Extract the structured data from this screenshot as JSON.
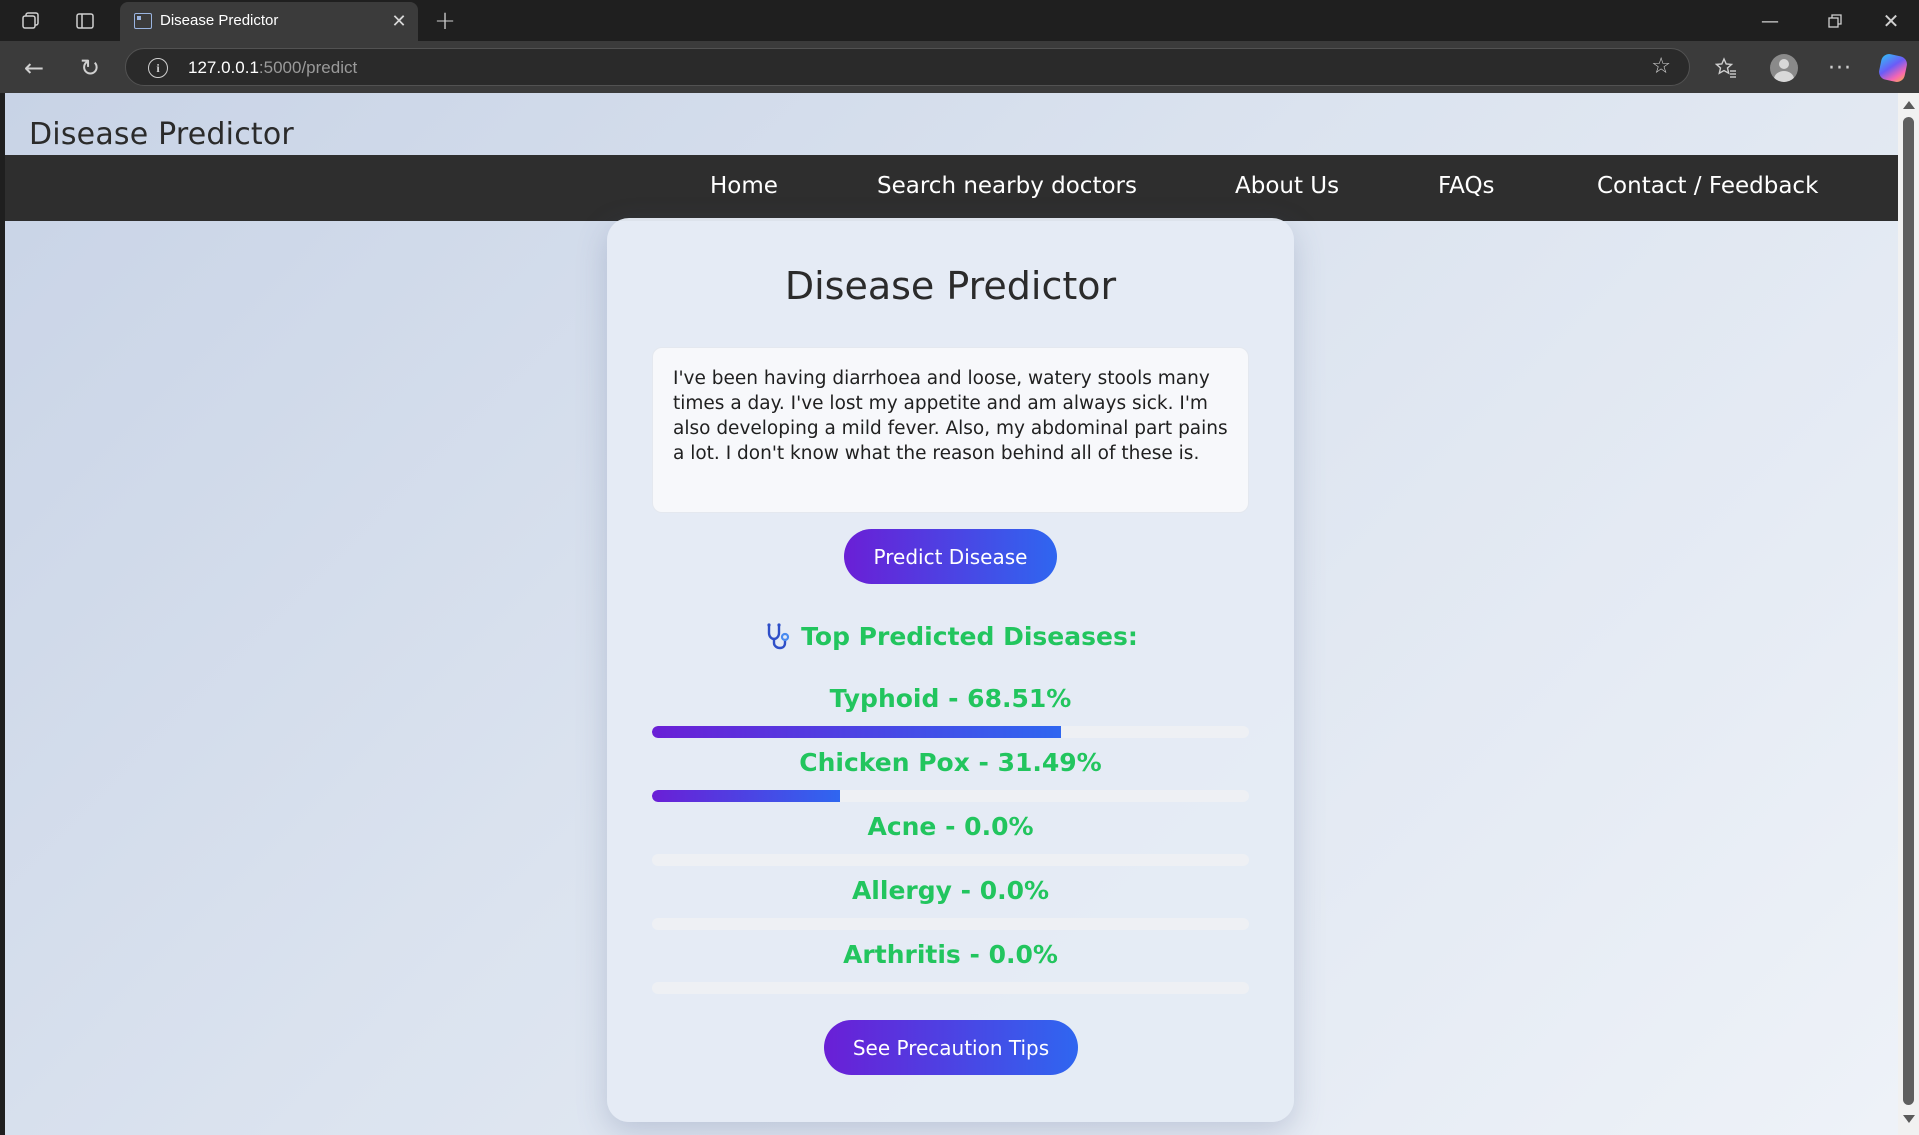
{
  "browser": {
    "tab_title": "Disease Predictor",
    "url_host": "127.0.0.1",
    "url_rest": ":5000/predict"
  },
  "site": {
    "title": "Disease Predictor",
    "nav": [
      "Home",
      "Search nearby doctors",
      "About Us",
      "FAQs",
      "Contact / Feedback"
    ]
  },
  "card": {
    "title": "Disease Predictor",
    "symptoms_text": "I've been having diarrhoea and loose, watery stools many times a day. I've lost my appetite and am always sick. I'm also developing a mild fever. Also, my abdominal part pains a lot. I don't know what the reason behind all of these is.",
    "predict_label": "Predict Disease",
    "results_heading": "Top Predicted Diseases:",
    "results": [
      {
        "label": "Typhoid - 68.51%",
        "percent": 68.51
      },
      {
        "label": "Chicken Pox - 31.49%",
        "percent": 31.49
      },
      {
        "label": "Acne - 0.0%",
        "percent": 0.0
      },
      {
        "label": "Allergy - 0.0%",
        "percent": 0.0
      },
      {
        "label": "Arthritis - 0.0%",
        "percent": 0.0
      }
    ],
    "precaution_label": "See Precaution Tips"
  },
  "colors": {
    "accent_start": "#6a1fd6",
    "accent_end": "#2f66f0",
    "result_green": "#22c55e",
    "nav_bg": "#2e2e2e"
  },
  "icons": [
    "workspaces-icon",
    "tab-actions-icon",
    "close-icon",
    "plus-icon",
    "back-arrow-icon",
    "reload-icon",
    "info-icon",
    "star-icon",
    "favorites-icon",
    "profile-icon",
    "more-icon",
    "copilot-icon",
    "stethoscope-icon"
  ]
}
